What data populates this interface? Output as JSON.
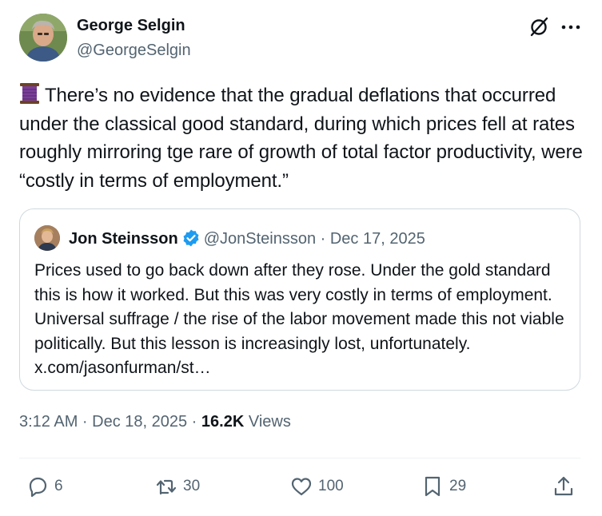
{
  "author": {
    "display_name": "George Selgin",
    "handle": "@GeorgeSelgin"
  },
  "tweet": {
    "emoji": "spool-of-thread",
    "text": "There’s no evidence that the gradual deflations that occurred under the classical good standard, during which prices fell at rates roughly mirroring tge rare of growth of total factor productivity, were “costly in terms of employment.”"
  },
  "quote": {
    "display_name": "Jon Steinsson",
    "verified": true,
    "meta": "@JonSteinsson · Dec 17, 2025",
    "text": "Prices used to go back down after they rose. Under the gold standard this is how it worked. But this was very costly in terms of employment. Universal suffrage / the rise of the labor movement made this not viable politically. But this lesson is increasingly lost, unfortunately. x.com/jasonfurman/st…"
  },
  "timestamp": {
    "datetime": "3:12 AM · Dec 18, 2025 · ",
    "views_count": "16.2K",
    "views_label": " Views"
  },
  "actions": {
    "replies": "6",
    "reposts": "30",
    "likes": "100",
    "bookmarks": "29"
  },
  "colors": {
    "text_primary": "#0f1419",
    "text_secondary": "#536471",
    "verified_blue": "#1d9bf0",
    "border": "#cfd9de"
  }
}
